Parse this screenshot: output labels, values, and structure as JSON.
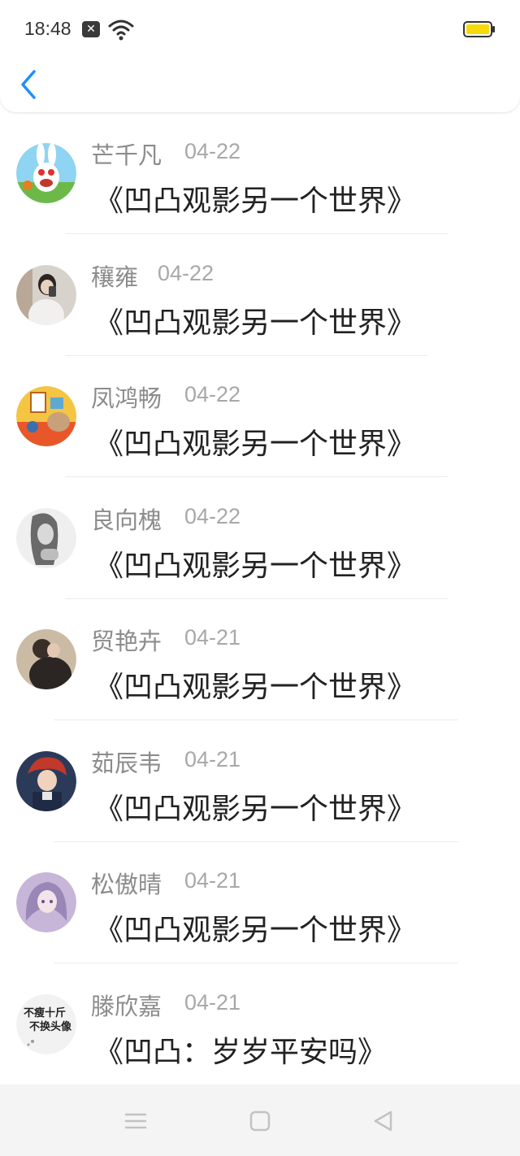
{
  "status_bar": {
    "time": "18:48",
    "notification_icon": "close-notification-icon",
    "wifi_icon": "wifi-icon",
    "battery_icon": "battery-icon",
    "battery_color": "#f5d90a"
  },
  "nav": {
    "back_icon": "back-chevron-icon",
    "accent_color": "#1e90ff"
  },
  "messages": [
    {
      "name": "芒千凡",
      "date": "04-22",
      "title": "《凹凸观影另一个世界》",
      "avatar": "rabbid-cartoon-avatar"
    },
    {
      "name": "穰雍",
      "date": "04-22",
      "title": "《凹凸观影另一个世界》",
      "avatar": "girl-selfie-avatar"
    },
    {
      "name": "凤鸿畅",
      "date": "04-22",
      "title": "《凹凸观影另一个世界》",
      "avatar": "cartoon-room-avatar"
    },
    {
      "name": "良向槐",
      "date": "04-22",
      "title": "《凹凸观影另一个世界》",
      "avatar": "bw-portrait-avatar"
    },
    {
      "name": "贸艳卉",
      "date": "04-21",
      "title": "《凹凸观影另一个世界》",
      "avatar": "couple-hug-avatar"
    },
    {
      "name": "茹辰韦",
      "date": "04-21",
      "title": "《凹凸观影另一个世界》",
      "avatar": "anime-boy-avatar"
    },
    {
      "name": "松傲晴",
      "date": "04-21",
      "title": "《凹凸观影另一个世界》",
      "avatar": "anime-girl-avatar"
    },
    {
      "name": "滕欣嘉",
      "date": "04-21",
      "title": "《凹凸：岁岁平安吗》",
      "avatar": "text-avatar",
      "avatar_text": [
        "不瘦十斤",
        "不换头像"
      ]
    }
  ],
  "system_nav": {
    "menu_icon": "menu-icon",
    "home_icon": "home-icon",
    "back_icon": "back-triangle-icon"
  }
}
